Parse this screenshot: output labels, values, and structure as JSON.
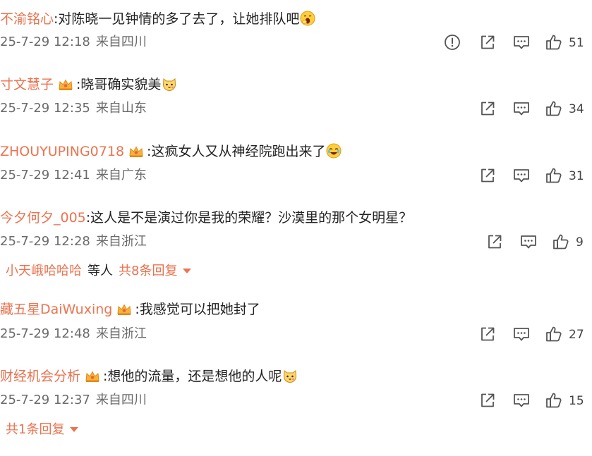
{
  "comments": [
    {
      "username": "不渝铭心",
      "content": "对陈晓一见钟情的多了去了，让她排队吧",
      "emoji": "yawning-face",
      "time": "25-7-29 12:18",
      "location": "来自四川",
      "likes": "51",
      "has_report": true,
      "has_badge": false
    },
    {
      "username": "寸文慧子",
      "content": "晓哥确实貌美",
      "emoji": "cat-face",
      "time": "25-7-29 12:35",
      "location": "来自山东",
      "likes": "34",
      "has_report": false,
      "has_badge": true
    },
    {
      "username": "ZHOUYUPING0718",
      "content": "这疯女人又从神经院跑出来了",
      "emoji": "rolling-laugh-face",
      "time": "25-7-29 12:41",
      "location": "来自广东",
      "likes": "31",
      "has_report": false,
      "has_badge": true
    },
    {
      "username": "今夕何夕_005",
      "content": "这人是不是演过你是我的荣耀？沙漠里的那个女明星？",
      "emoji": "",
      "time": "25-7-29 12:28",
      "location": "来自浙江",
      "likes": "9",
      "has_report": false,
      "has_badge": false
    },
    {
      "username": "藏五星DaiWuxing",
      "content": "我感觉可以把她封了",
      "emoji": "",
      "time": "25-7-29 12:48",
      "location": "来自浙江",
      "likes": "27",
      "has_report": false,
      "has_badge": true
    },
    {
      "username": "财经机会分析",
      "content": "想他的流量，还是想他的人呢",
      "emoji": "cat-face",
      "time": "25-7-29 12:37",
      "location": "来自四川",
      "likes": "15",
      "has_report": false,
      "has_badge": true
    }
  ],
  "replies_1": {
    "user": "小天峨哈哈哈",
    "middle": "等人",
    "label": "共8条回复"
  },
  "replies_2": {
    "label": "共1条回复"
  },
  "colors": {
    "accent": "#eb7350",
    "meta": "#6b6b6b",
    "icon": "#555555"
  },
  "icons": {
    "report": "exclamation-circle-icon",
    "share": "share-icon",
    "comment": "comment-icon",
    "like": "thumbs-up-icon",
    "badge": "crown-badge-icon"
  }
}
